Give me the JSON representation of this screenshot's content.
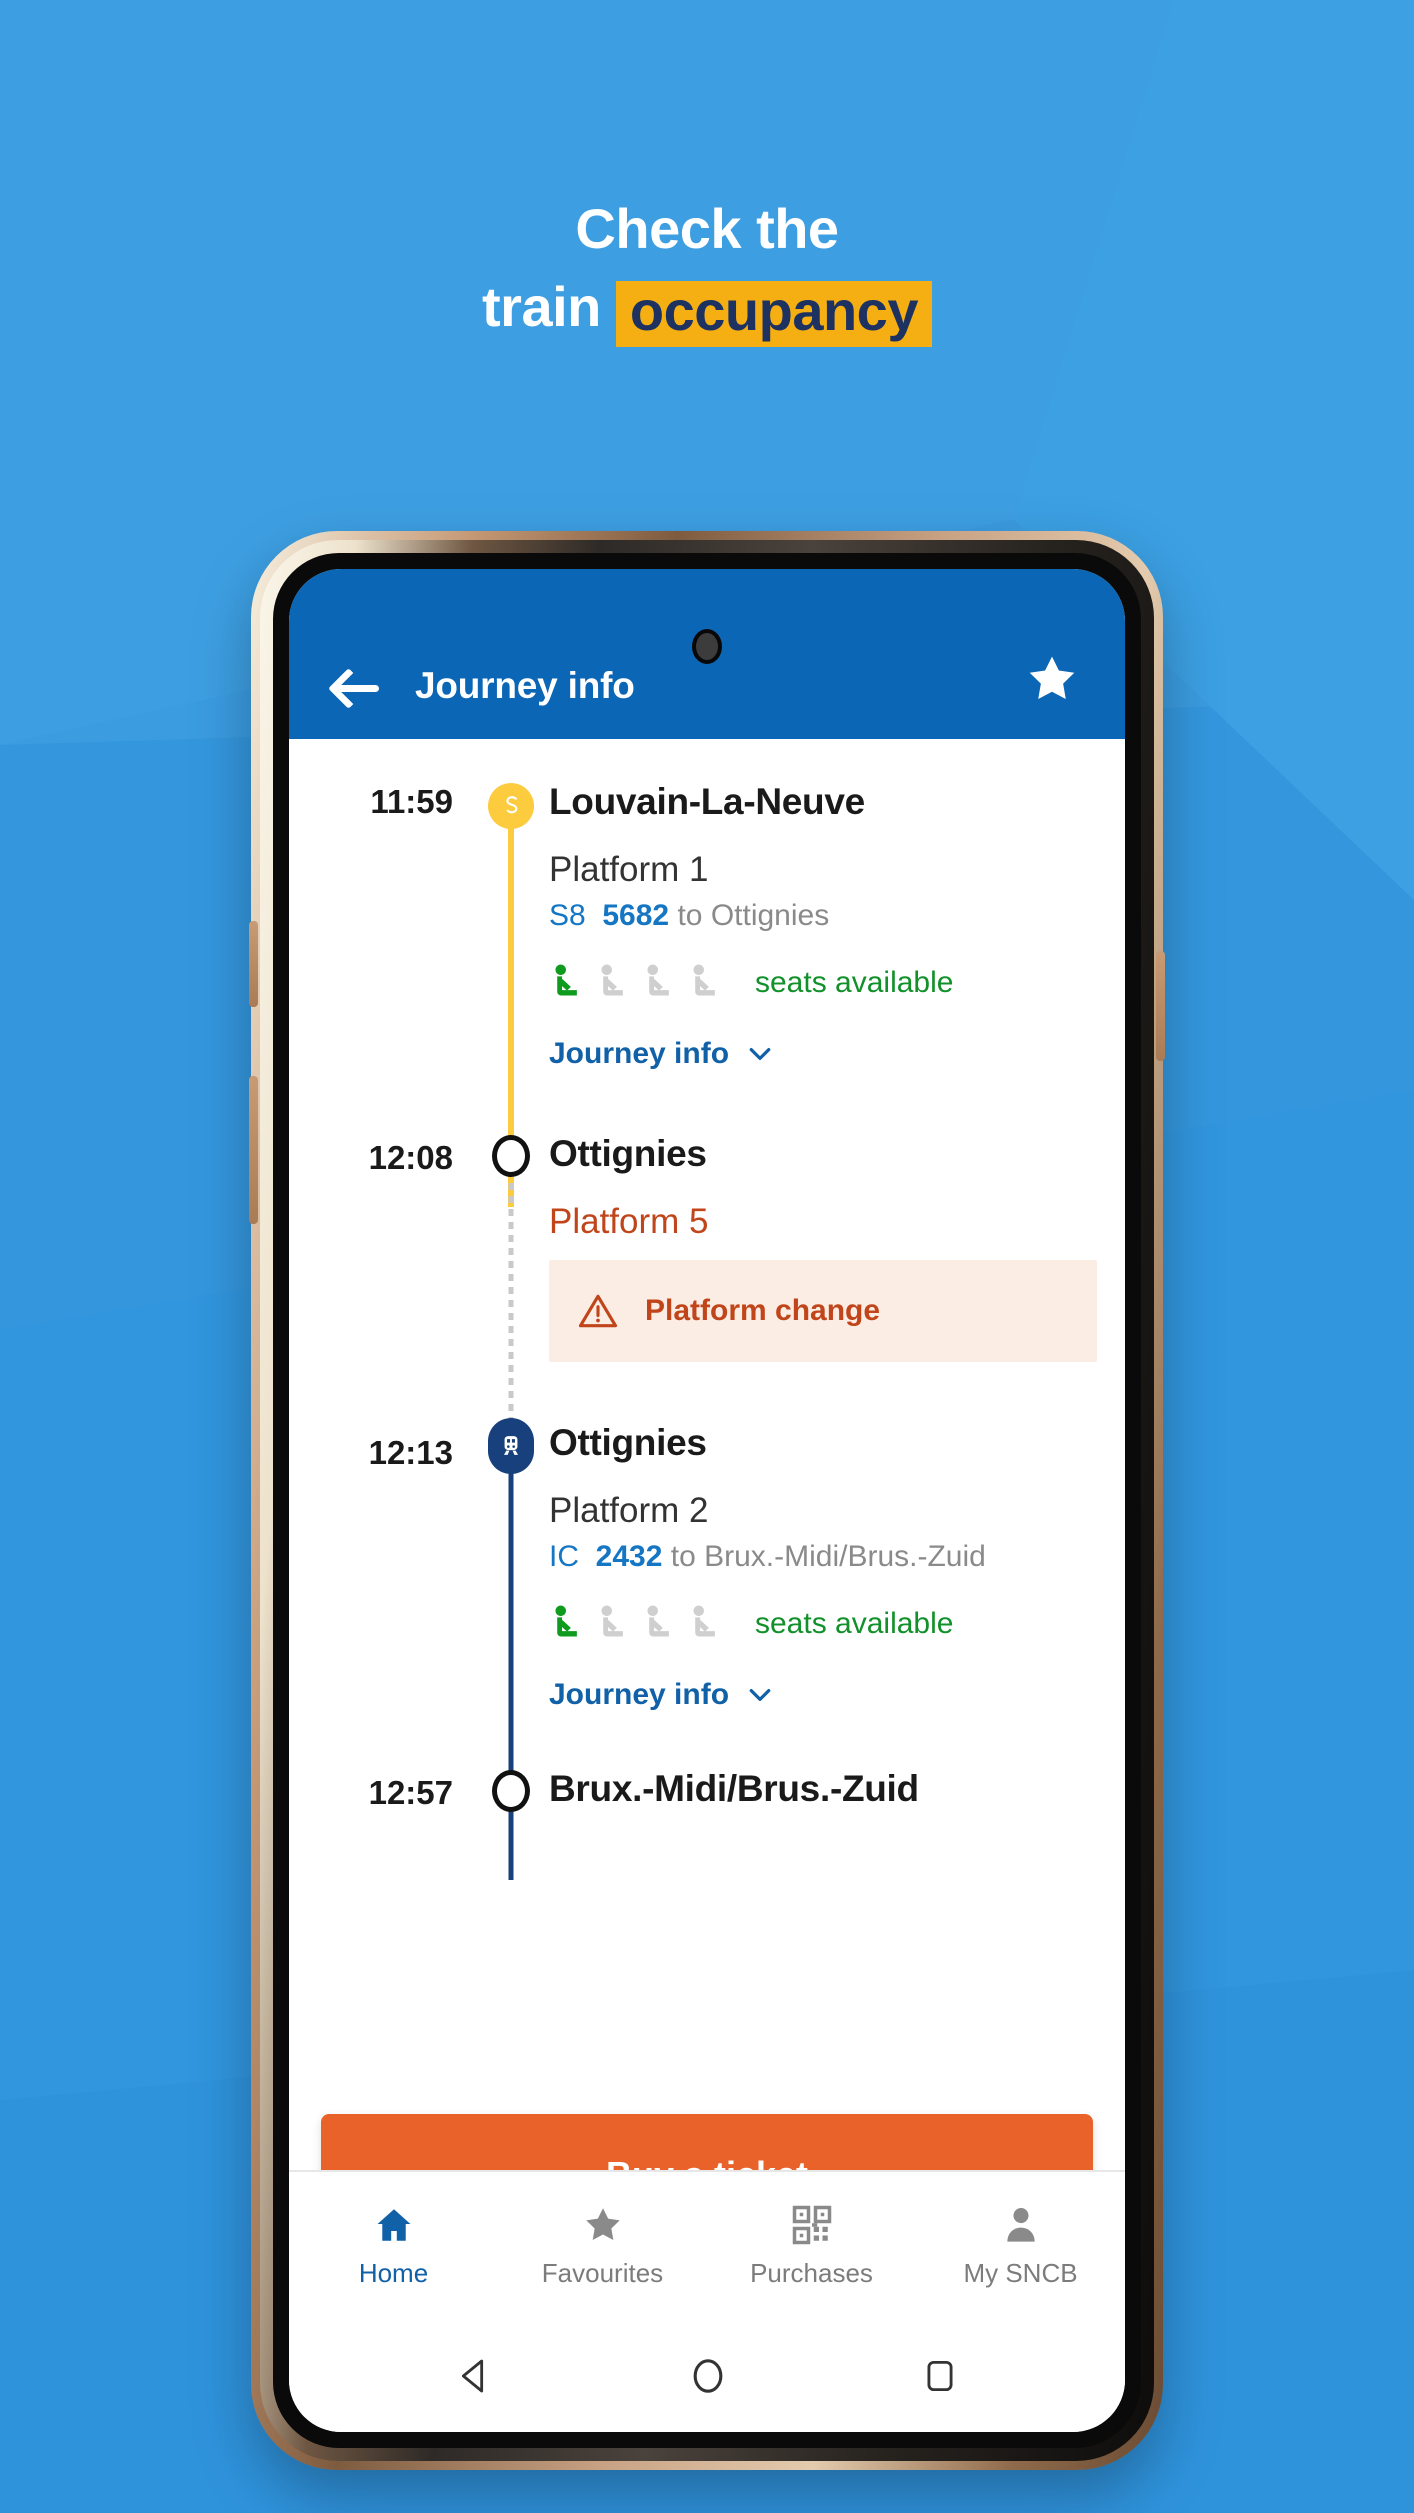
{
  "promo": {
    "line1": "Check the",
    "line2_prefix": "train ",
    "line2_highlight": "occupancy",
    "highlight_bg": "#F6AF12",
    "highlight_text_color": "#1D3261",
    "background_color": "#3B9CE0"
  },
  "appbar": {
    "title": "Journey info",
    "back_icon": "arrow-left-icon",
    "favourite_icon": "star-icon",
    "background_color": "#0B66B5"
  },
  "journey": {
    "stops": [
      {
        "time": "11:59",
        "name": "Louvain-La-Neuve",
        "node_type": "s-train-badge",
        "platform": "Platform 1",
        "train_code": "S8",
        "train_number": "5682",
        "train_destination": "to Ottignies",
        "occupancy": {
          "filled": 1,
          "total": 4,
          "label": "seats available",
          "color": "#12912B"
        },
        "journey_info_label": "Journey info",
        "journey_info_icon": "chevron-down-icon"
      },
      {
        "time": "12:08",
        "name": "Ottignies",
        "node_type": "circle",
        "platform": "Platform 5",
        "platform_alert": true,
        "warning": {
          "icon": "warning-triangle-icon",
          "text": "Platform change",
          "bg_color": "#FBEDE4",
          "text_color": "#C0451A"
        }
      },
      {
        "time": "12:13",
        "name": "Ottignies",
        "node_type": "train-badge",
        "platform": "Platform 2",
        "train_code": "IC",
        "train_number": "2432",
        "train_destination": "to Brux.-Midi/Brus.-Zuid",
        "occupancy": {
          "filled": 1,
          "total": 4,
          "label": "seats available",
          "color": "#12912B"
        },
        "journey_info_label": "Journey info",
        "journey_info_icon": "chevron-down-icon"
      },
      {
        "time": "12:57",
        "name": "Brux.-Midi/Brus.-Zuid",
        "node_type": "circle"
      }
    ]
  },
  "cta": {
    "label": "Buy a ticket",
    "color": "#E8622A"
  },
  "bottom_nav": {
    "items": [
      {
        "label": "Home",
        "icon": "home-icon",
        "active": true
      },
      {
        "label": "Favourites",
        "icon": "star-icon",
        "active": false
      },
      {
        "label": "Purchases",
        "icon": "qr-code-icon",
        "active": false
      },
      {
        "label": "My SNCB",
        "icon": "person-icon",
        "active": false
      }
    ],
    "active_color": "#1161A8",
    "inactive_color": "#7C7C7C"
  },
  "android_nav": {
    "back_icon": "android-back-icon",
    "home_icon": "android-home-icon",
    "recents_icon": "android-recents-icon"
  }
}
